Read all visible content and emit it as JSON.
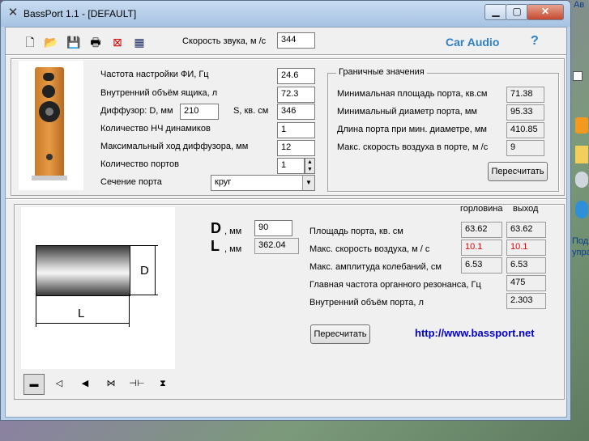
{
  "window": {
    "title": "BassPort 1.1 - [DEFAULT]"
  },
  "toolbar": {
    "sound_speed_label": "Скорость звука, м /с",
    "sound_speed_value": "344",
    "brand": "Car Audio",
    "help": "?"
  },
  "params": {
    "tuning_label": "Частота настройки ФИ, Гц",
    "tuning_value": "24.6",
    "volume_label": "Внутренний объём ящика, л",
    "volume_value": "72.3",
    "diffuser_label": "Диффузор: D, мм",
    "diffuser_d_value": "210",
    "s_label": "S, кв. см",
    "s_value": "346",
    "drivers_label": "Количество НЧ динамиков",
    "drivers_value": "1",
    "xmax_label": "Максимальный ход диффузора, мм",
    "xmax_value": "12",
    "ports_label": "Количество портов",
    "ports_value": "1",
    "section_label": "Сечение порта",
    "section_value": "круг"
  },
  "limits": {
    "title": "Граничные значения",
    "min_area_label": "Минимальная площадь порта, кв.см",
    "min_area_value": "71.38",
    "min_diam_label": "Минимальный диаметр порта, мм",
    "min_diam_value": "95.33",
    "len_label": "Длина порта при мин. диаметре, мм",
    "len_value": "410.85",
    "air_label": "Макс. скорость воздуха в порте, м /с",
    "air_value": "9",
    "recalc_label": "Пересчитать"
  },
  "port": {
    "d_letter": "D",
    "d_unit": ", мм",
    "d_value": "90",
    "l_letter": "L",
    "l_unit": ", мм",
    "l_value": "362.04",
    "diagram_d": "D",
    "diagram_l": "L",
    "col_throat": "горловина",
    "col_exit": "выход",
    "area_label": "Площадь порта, кв. см",
    "area_throat": "63.62",
    "area_exit": "63.62",
    "airspeed_label": "Макс. скорость воздуха, м / с",
    "airspeed_throat": "10.1",
    "airspeed_exit": "10.1",
    "amp_label": "Макс. амплитуда колебаний, см",
    "amp_throat": "6.53",
    "amp_exit": "6.53",
    "organ_label": "Главная частота органного резонанса, Гц",
    "organ_value": "475",
    "port_vol_label": "Внутренний объём порта, л",
    "port_vol_value": "2.303",
    "recalc_label": "Пересчитать",
    "url": "http://www.bassport.net"
  },
  "desktop": {
    "frag1": "Ав",
    "frag2": "Под",
    "frag3": "упра"
  },
  "colors": {
    "accent": "#2e7fc4",
    "warning": "#e00000",
    "url": "#0000cc"
  }
}
